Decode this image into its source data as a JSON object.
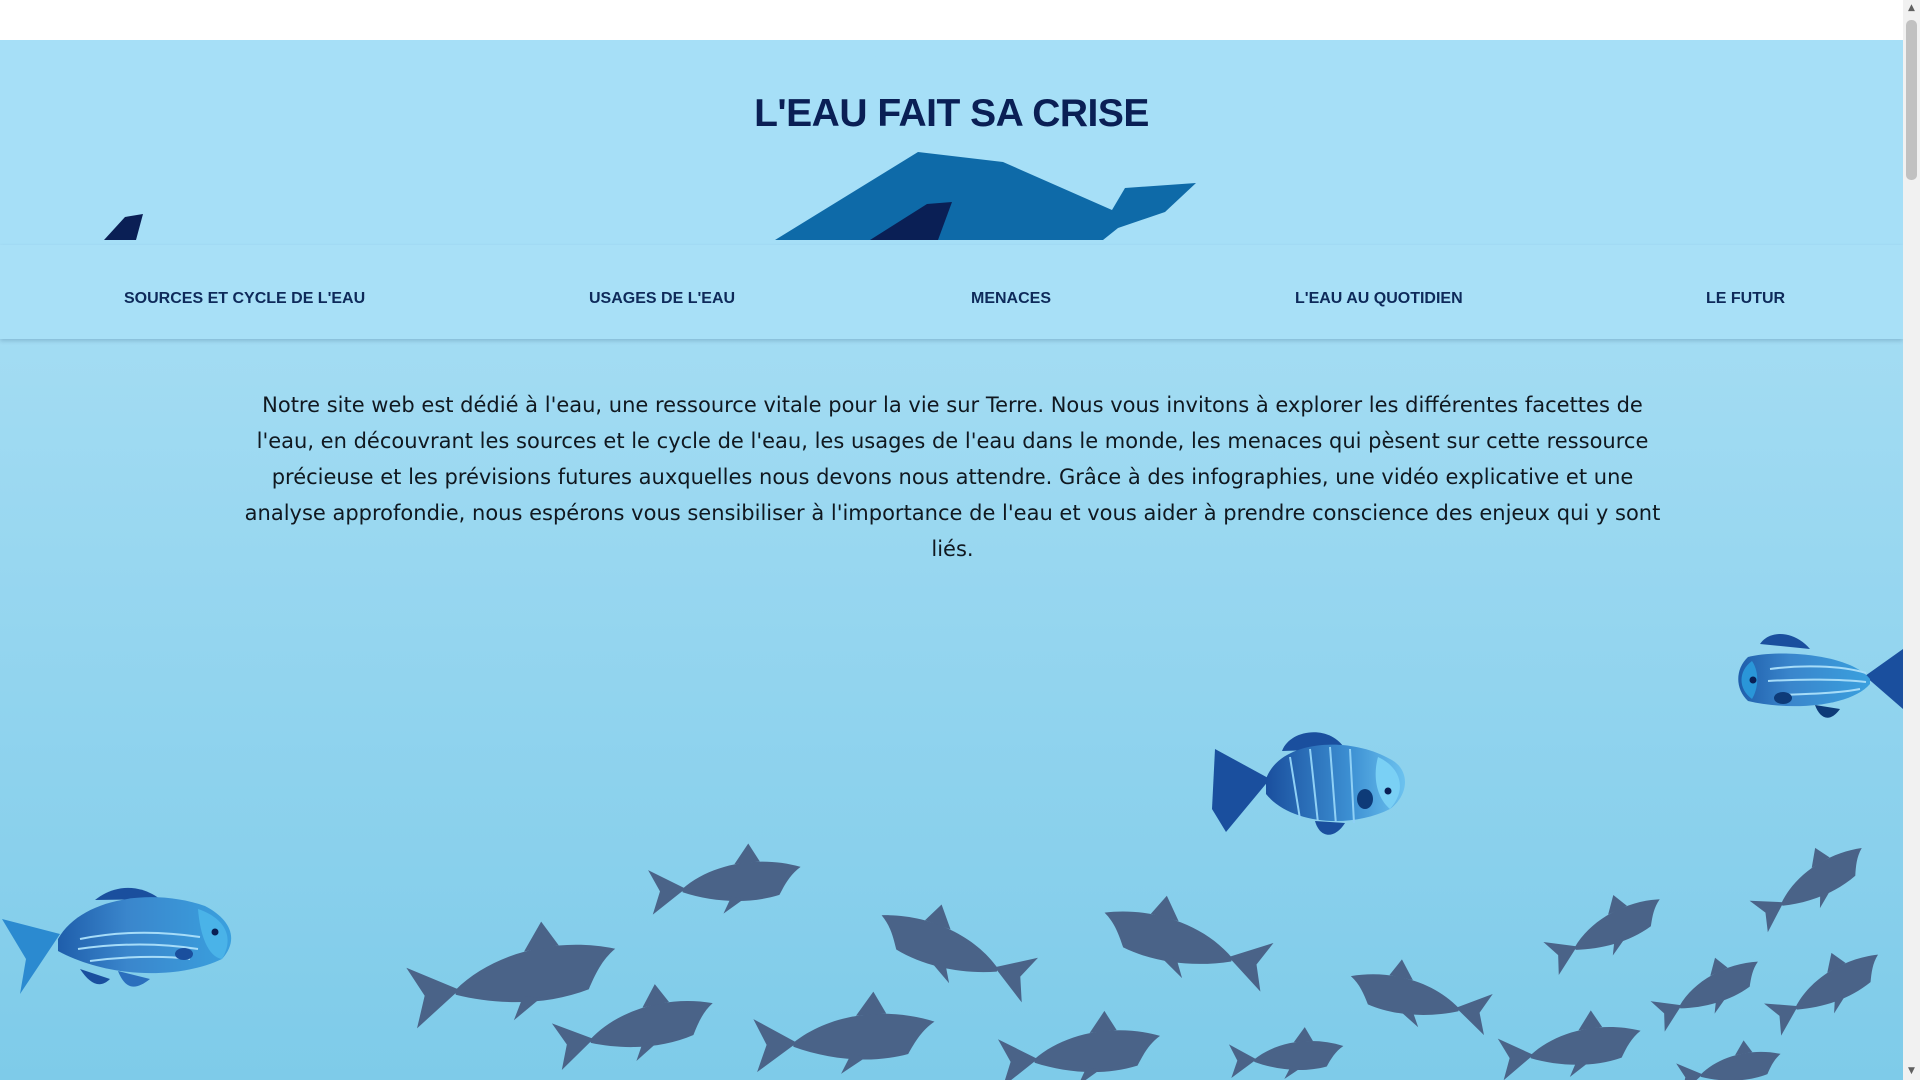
{
  "site": {
    "title": "L'EAU FAIT SA CRISE"
  },
  "nav": {
    "items": [
      {
        "label": "SOURCES ET CYCLE DE L'EAU"
      },
      {
        "label": "USAGES DE L'EAU"
      },
      {
        "label": "MENACES"
      },
      {
        "label": "L'EAU AU QUOTIDIEN"
      },
      {
        "label": "LE FUTUR"
      }
    ]
  },
  "intro": {
    "text": "Notre site web est dédié à l'eau, une ressource vitale pour la vie sur Terre. Nous vous invitons à explorer les différentes facettes de l'eau, en découvrant les sources et le cycle de l'eau, les usages de l'eau dans le monde, les menaces qui pèsent sur cette ressource précieuse et les prévisions futures auxquelles nous devons nous attendre. Grâce à des infographies, une vidéo explicative et une analyse approfondie, nous espérons vous sensibiliser à l'importance de l'eau et vous aider à prendre conscience des enjeux qui y sont liés."
  },
  "colors": {
    "mountain": "#a6dff7",
    "iceberg": "#0e6aa8",
    "iceberg_dark": "#0a1f55",
    "title": "#0a1f55",
    "school_fish": "#4a6388",
    "fish_light": "#4aa6dc",
    "fish_dark": "#1f5eab"
  },
  "icons": {
    "scroll_up": "▲",
    "scroll_down": "▼"
  }
}
